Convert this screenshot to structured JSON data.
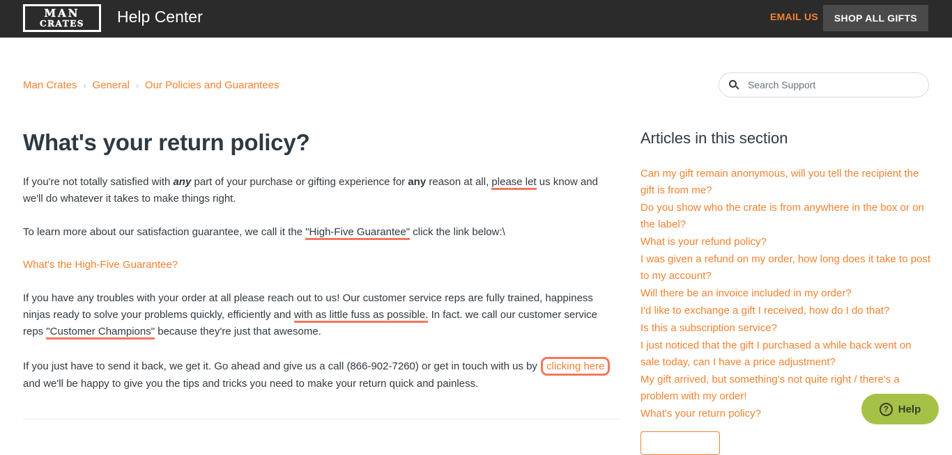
{
  "header": {
    "logo_line1": "MAN",
    "logo_line2": "CRATES",
    "title": "Help Center",
    "email_us": "EMAIL US",
    "shop_all_gifts": "SHOP ALL GIFTS",
    "background_color": "#2b2b2b",
    "accent_color": "#f5812f"
  },
  "breadcrumb": {
    "items": [
      {
        "label": "Man Crates"
      },
      {
        "label": "General"
      },
      {
        "label": "Our Policies and Guarantees"
      }
    ],
    "separator": "›"
  },
  "search": {
    "placeholder": "Search Support",
    "value": "",
    "icon": "search-icon"
  },
  "article": {
    "title": "What's your return policy?",
    "p1": {
      "t1": "If you're not totally satisfied with ",
      "bold_italic": "any",
      "t2": " part of your purchase or gifting experience for ",
      "bold": "any",
      "t3": " reason at all, ",
      "underlined": "please let",
      "t4": " us know and we'll do whatever it takes to make things right."
    },
    "p2": {
      "t1": "To learn more about our satisfaction guarantee, we call it the ",
      "underlined": "\"High-Five Guarantee\"",
      "t2": " click the link below:\\"
    },
    "link_high_five": "What's the High-Five Guarantee?",
    "p3": {
      "t1": "If you have any troubles with your order at all please reach out to us! Our customer service reps are fully trained, happiness ninjas ready to solve your problems quickly, efficiently and ",
      "underlined1": "with as little fuss as possible.",
      "t2": " In fact. we call our customer service reps ",
      "underlined2": "\"Customer Champions\"",
      "t3": " because they're just that awesome."
    },
    "p4": {
      "t1": "If you just have to send it back, we get it. Go ahead and give us a call (866-902-7260) or get in touch with us by ",
      "boxed_link": "clicking here",
      "t2": " and we'll be happy to give you the tips and tricks you need to make your return quick and painless."
    },
    "annotation_color": "#f4775c"
  },
  "sidebar": {
    "title": "Articles in this section",
    "articles": [
      {
        "label": "Can my gift remain anonymous, will you tell the recipient the gift is from me?"
      },
      {
        "label": "Do you show who the crate is from anywhere in the box or on the label?"
      },
      {
        "label": "What is your refund policy?"
      },
      {
        "label": "I was given a refund on my order, how long does it take to post to my account?"
      },
      {
        "label": "Will there be an invoice included in my order?"
      },
      {
        "label": "I'd like to exchange a gift I received, how do I do that?"
      },
      {
        "label": "Is this a subscription service?"
      },
      {
        "label": "I just noticed that the gift I purchased a while back went on sale today, can I have a price adjustment?"
      },
      {
        "label": "My gift arrived, but something's not quite right / there's a problem with my order!"
      },
      {
        "label": "What's your return policy?"
      }
    ]
  },
  "help_widget": {
    "label": "Help",
    "icon": "question-mark-icon",
    "color": "#a5c246"
  }
}
